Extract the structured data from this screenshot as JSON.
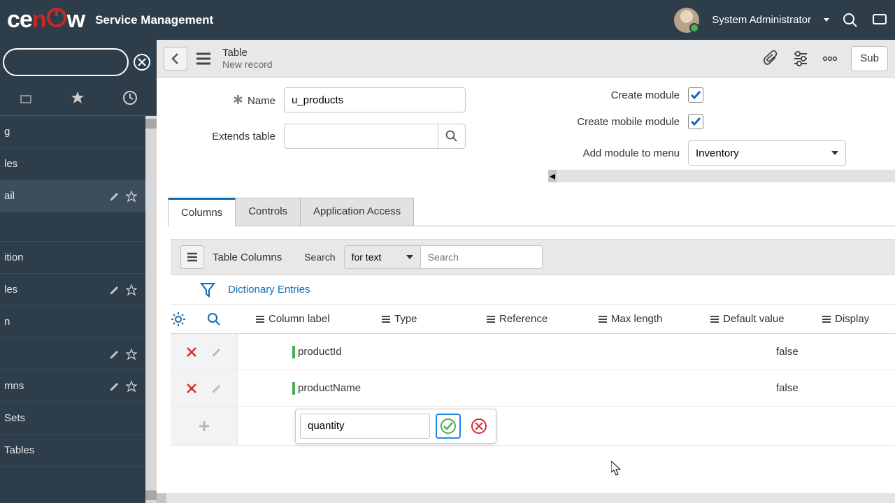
{
  "header": {
    "app_title": "Service Management",
    "user_name": "System Administrator"
  },
  "sidebar": {
    "items": [
      {
        "label": "g"
      },
      {
        "label": "les"
      },
      {
        "label": "ail",
        "actions": true
      },
      {
        "label": "ition"
      },
      {
        "label": "les",
        "actions": true
      },
      {
        "label": "n"
      },
      {
        "label": "",
        "actions": true
      },
      {
        "label": "mns",
        "actions": true
      },
      {
        "label": "Sets"
      },
      {
        "label": "Tables"
      }
    ]
  },
  "mainbar": {
    "title": "Table",
    "subtitle": "New record",
    "submit": "Sub"
  },
  "form": {
    "name_label": "Name",
    "name_value": "u_products",
    "extends_label": "Extends table",
    "create_module_label": "Create module",
    "create_mobile_label": "Create mobile module",
    "add_menu_label": "Add module to menu",
    "add_menu_value": "Inventory"
  },
  "tabs": [
    "Columns",
    "Controls",
    "Application Access"
  ],
  "columns_section": {
    "title": "Table Columns",
    "search_label": "Search",
    "search_mode": "for text",
    "search_placeholder": "Search",
    "filter_label": "Dictionary Entries",
    "headers": {
      "col_label": "Column label",
      "type": "Type",
      "reference": "Reference",
      "max_length": "Max length",
      "default_value": "Default value",
      "display": "Display"
    },
    "rows": [
      {
        "label": "productId",
        "display": "false"
      },
      {
        "label": "productName",
        "display": "false"
      }
    ],
    "new_value": "quantity"
  }
}
